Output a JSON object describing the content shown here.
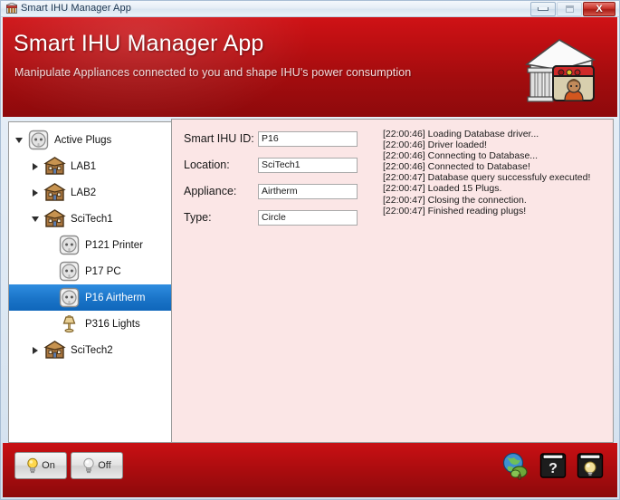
{
  "window": {
    "title": "Smart IHU Manager App",
    "title_icon": "app-building-icon",
    "minimize_label": "Minimize",
    "maximize_label": "Maximize",
    "close_label": "X"
  },
  "header": {
    "title": "Smart IHU Manager App",
    "subtitle": "Manipulate Appliances connected to you and shape IHU's power consumption",
    "logo_icon": "ihu-building-logo",
    "background_color": "#c00f12"
  },
  "tree": {
    "nodes": [
      {
        "label": "Active Plugs",
        "icon": "plug-socket-icon",
        "twisty": "open",
        "indent": 0,
        "selected": false
      },
      {
        "label": "LAB1",
        "icon": "building-icon",
        "twisty": "closed",
        "indent": 1,
        "selected": false
      },
      {
        "label": "LAB2",
        "icon": "building-icon",
        "twisty": "closed",
        "indent": 1,
        "selected": false
      },
      {
        "label": "SciTech1",
        "icon": "building-icon",
        "twisty": "open",
        "indent": 1,
        "selected": false
      },
      {
        "label": "P121 Printer",
        "icon": "plug-socket-icon",
        "twisty": "none",
        "indent": 2,
        "selected": false
      },
      {
        "label": "P17 PC",
        "icon": "plug-socket-icon",
        "twisty": "none",
        "indent": 2,
        "selected": false
      },
      {
        "label": "P16 Airtherm",
        "icon": "plug-socket-icon",
        "twisty": "none",
        "indent": 2,
        "selected": true
      },
      {
        "label": "P316 Lights",
        "icon": "lamp-icon",
        "twisty": "none",
        "indent": 2,
        "selected": false
      },
      {
        "label": "SciTech2",
        "icon": "building-icon",
        "twisty": "closed",
        "indent": 1,
        "selected": false
      }
    ],
    "selection_color": "#1a74c8"
  },
  "form": {
    "fields": [
      {
        "label": "Smart IHU ID:",
        "value": "P16"
      },
      {
        "label": "Location:",
        "value": "SciTech1"
      },
      {
        "label": "Appliance:",
        "value": "Airtherm"
      },
      {
        "label": "Type:",
        "value": "Circle"
      }
    ]
  },
  "log": {
    "lines": [
      "[22:00:46] Loading Database driver...",
      "[22:00:46] Driver loaded!",
      "[22:00:46] Connecting to Database...",
      "[22:00:46] Connected to Database!",
      "[22:00:47] Database query successfuly executed!",
      "[22:00:47] Loaded 15 Plugs.",
      "[22:00:47] Closing the connection.",
      "[22:00:47] Finished reading plugs!"
    ]
  },
  "footer": {
    "on_label": "On",
    "off_label": "Off",
    "on_icon": "lightbulb-on-icon",
    "off_icon": "lightbulb-off-icon",
    "icons": [
      {
        "name": "globe-tree-icon"
      },
      {
        "name": "help-book-icon",
        "glyph": "?"
      },
      {
        "name": "tips-book-icon",
        "glyph": "bulb"
      }
    ]
  }
}
